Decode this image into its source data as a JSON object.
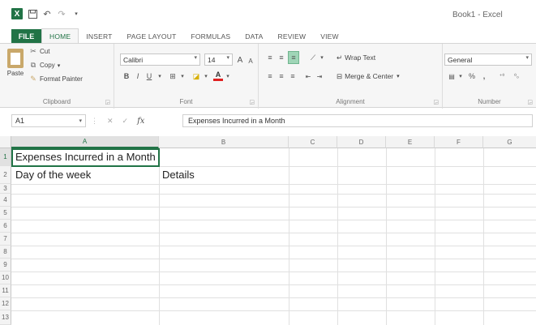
{
  "app": {
    "logo_letter": "X",
    "window_title": "Book1 - Excel"
  },
  "colors": {
    "accent": "#217346",
    "ribbon_bg": "#f6f6f6",
    "gridline": "#e0e0e0"
  },
  "quick_access": [
    "save-icon",
    "undo-icon",
    "redo-icon",
    "customize-icon"
  ],
  "tabs": [
    {
      "label": "FILE"
    },
    {
      "label": "HOME",
      "active": true
    },
    {
      "label": "INSERT"
    },
    {
      "label": "PAGE LAYOUT"
    },
    {
      "label": "FORMULAS"
    },
    {
      "label": "DATA"
    },
    {
      "label": "REVIEW"
    },
    {
      "label": "VIEW"
    }
  ],
  "ribbon": {
    "clipboard": {
      "paste": "Paste",
      "cut": "Cut",
      "copy": "Copy",
      "format_painter": "Format Painter",
      "label": "Clipboard"
    },
    "font": {
      "font_name": "Calibri",
      "font_size": "14",
      "grow": "A",
      "shrink": "A",
      "bold": "B",
      "italic": "I",
      "underline": "U",
      "label": "Font"
    },
    "alignment": {
      "wrap_text": "Wrap Text",
      "merge_center": "Merge & Center",
      "label": "Alignment"
    },
    "number": {
      "format": "General",
      "percent": "%",
      "comma": ",",
      "label": "Number"
    }
  },
  "formula_bar": {
    "name_box": "A1",
    "fx": "fx",
    "content": "Expenses Incurred in a Month"
  },
  "sheet": {
    "columns": [
      "A",
      "B",
      "C",
      "D",
      "E",
      "F",
      "G"
    ],
    "rows": [
      "1",
      "2",
      "3",
      "4",
      "5",
      "6",
      "7",
      "8",
      "9",
      "10",
      "11",
      "12",
      "13"
    ],
    "cells": {
      "A1": "Expenses Incurred in a Month",
      "A2": "Day of the week",
      "B2": "Details"
    }
  }
}
